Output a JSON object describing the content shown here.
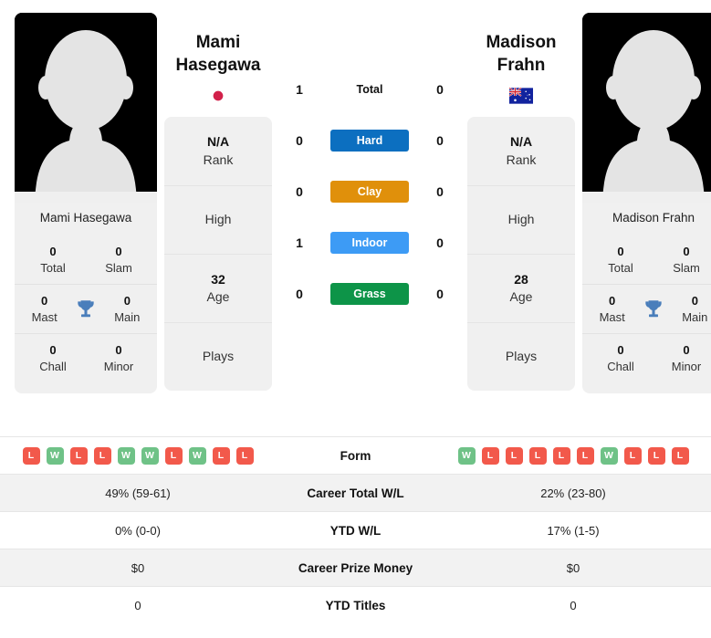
{
  "players": {
    "left": {
      "name_display": "Mami\nHasegawa",
      "name_full": "Mami Hasegawa",
      "flag": "japan-flag",
      "avatar": "player-avatar-placeholder",
      "titles": {
        "total_value": "0",
        "total_label": "Total",
        "slam_value": "0",
        "slam_label": "Slam",
        "mast_value": "0",
        "mast_label": "Mast",
        "main_value": "0",
        "main_label": "Main",
        "chall_value": "0",
        "chall_label": "Chall",
        "minor_value": "0",
        "minor_label": "Minor"
      },
      "info": {
        "rank_value": "N/A",
        "rank_label": "Rank",
        "high_value": "",
        "high_label": "High",
        "age_value": "32",
        "age_label": "Age",
        "plays_value": "",
        "plays_label": "Plays"
      },
      "form": [
        "L",
        "W",
        "L",
        "L",
        "W",
        "W",
        "L",
        "W",
        "L",
        "L"
      ],
      "career_wl": "49% (59-61)",
      "ytd_wl": "0% (0-0)",
      "career_prize": "$0",
      "ytd_titles": "0"
    },
    "right": {
      "name_display": "Madison\nFrahn",
      "name_full": "Madison Frahn",
      "flag": "australia-flag",
      "avatar": "player-avatar-placeholder",
      "titles": {
        "total_value": "0",
        "total_label": "Total",
        "slam_value": "0",
        "slam_label": "Slam",
        "mast_value": "0",
        "mast_label": "Mast",
        "main_value": "0",
        "main_label": "Main",
        "chall_value": "0",
        "chall_label": "Chall",
        "minor_value": "0",
        "minor_label": "Minor"
      },
      "info": {
        "rank_value": "N/A",
        "rank_label": "Rank",
        "high_value": "",
        "high_label": "High",
        "age_value": "28",
        "age_label": "Age",
        "plays_value": "",
        "plays_label": "Plays"
      },
      "form": [
        "W",
        "L",
        "L",
        "L",
        "L",
        "L",
        "W",
        "L",
        "L",
        "L"
      ],
      "career_wl": "22% (23-80)",
      "ytd_wl": "17% (1-5)",
      "career_prize": "$0",
      "ytd_titles": "0"
    }
  },
  "head_to_head": {
    "rows": [
      {
        "label": "Total",
        "left": "1",
        "right": "0",
        "color": "",
        "style": "plain"
      },
      {
        "label": "Hard",
        "left": "0",
        "right": "0",
        "color": "#0c6fc0",
        "style": "pill"
      },
      {
        "label": "Clay",
        "left": "0",
        "right": "0",
        "color": "#e0900b",
        "style": "pill"
      },
      {
        "label": "Indoor",
        "left": "1",
        "right": "0",
        "color": "#3d9bf5",
        "style": "pill"
      },
      {
        "label": "Grass",
        "left": "0",
        "right": "0",
        "color": "#0d9448",
        "style": "pill"
      }
    ]
  },
  "stats_table": {
    "rows": [
      {
        "label": "Form",
        "type": "form"
      },
      {
        "label": "Career Total W/L",
        "type": "text",
        "left_key": "career_wl",
        "right_key": "career_wl"
      },
      {
        "label": "YTD W/L",
        "type": "text",
        "left_key": "ytd_wl",
        "right_key": "ytd_wl"
      },
      {
        "label": "Career Prize Money",
        "type": "text",
        "left_key": "career_prize",
        "right_key": "career_prize"
      },
      {
        "label": "YTD Titles",
        "type": "text",
        "left_key": "ytd_titles",
        "right_key": "ytd_titles"
      }
    ]
  },
  "colors": {
    "win_badge": "#6fc287",
    "loss_badge": "#f2594b",
    "card_bg": "#f0f0f0",
    "row_shade": "#f2f2f2",
    "trophy": "#4a7ebb"
  }
}
